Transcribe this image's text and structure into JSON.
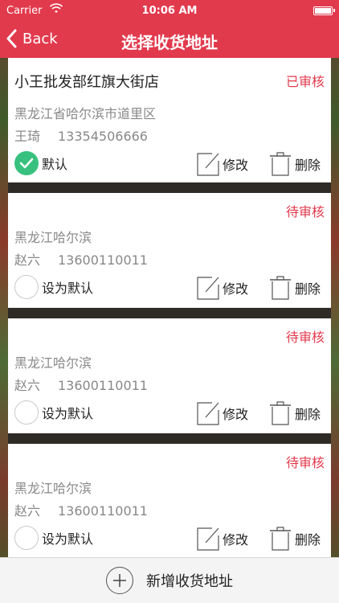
{
  "status_bar": {
    "carrier": "Carrier",
    "time": "10:06 AM"
  },
  "nav": {
    "back_label": "Back",
    "title": "选择收货地址"
  },
  "addresses": [
    {
      "shop_name": "小王批发部红旗大街店",
      "status": "已审核",
      "address": "黑龙江省哈尔滨市道里区",
      "contact_name": "王琦",
      "phone": "13354506666",
      "default_label": "默认",
      "is_default": true
    },
    {
      "shop_name": "",
      "status": "待审核",
      "address": "黑龙江哈尔滨",
      "contact_name": "赵六",
      "phone": "13600110011",
      "default_label": "设为默认",
      "is_default": false
    },
    {
      "shop_name": "",
      "status": "待审核",
      "address": "黑龙江哈尔滨",
      "contact_name": "赵六",
      "phone": "13600110011",
      "default_label": "设为默认",
      "is_default": false
    },
    {
      "shop_name": "",
      "status": "待审核",
      "address": "黑龙江哈尔滨",
      "contact_name": "赵六",
      "phone": "13600110011",
      "default_label": "设为默认",
      "is_default": false
    }
  ],
  "actions": {
    "edit_label": "修改",
    "delete_label": "删除"
  },
  "bottom": {
    "add_label": "新增收货地址"
  },
  "colors": {
    "accent": "#e23a4d",
    "check": "#38c17e"
  }
}
